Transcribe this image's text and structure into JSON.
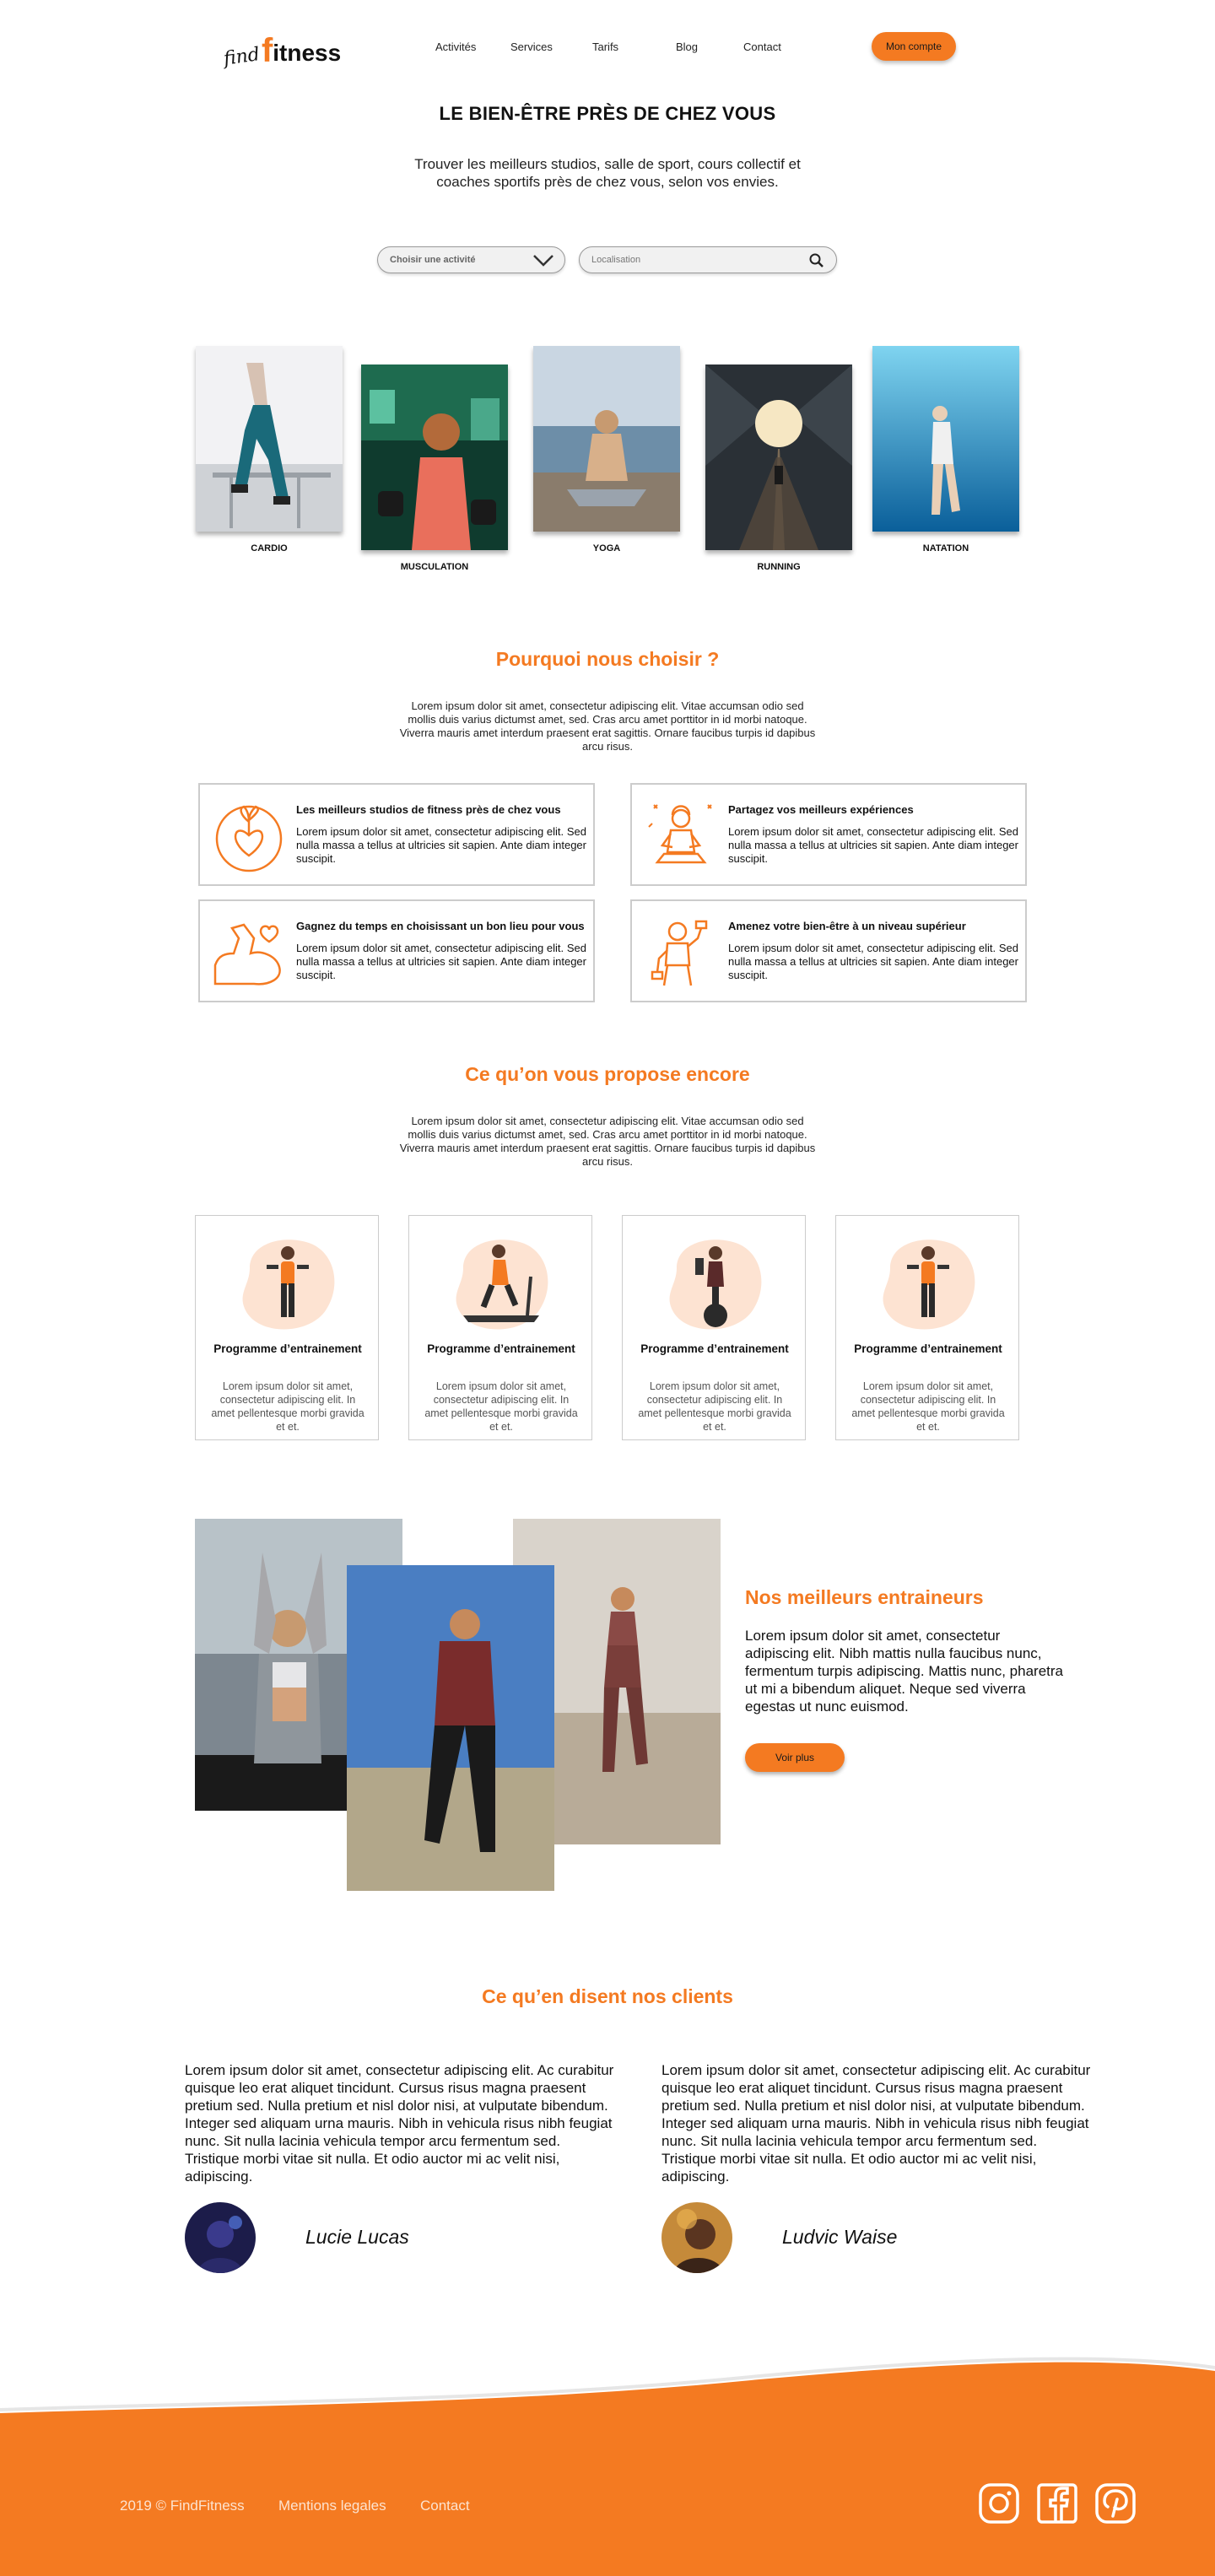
{
  "header": {
    "logo_find": "find",
    "logo_f": "f",
    "logo_rest": "itness",
    "nav": [
      "Activités",
      "Services",
      "Tarifs",
      "Blog",
      "Contact"
    ],
    "account_button": "Mon compte"
  },
  "hero": {
    "title": "LE BIEN-ÊTRE PRÈS DE CHEZ VOUS",
    "subtitle": "Trouver les meilleurs studios, salle de sport, cours collectif et coaches sportifs près de chez vous, selon vos envies.",
    "activity_select": "Choisir une activité",
    "location_placeholder": "Localisation"
  },
  "activities": [
    "CARDIO",
    "MUSCULATION",
    "YOGA",
    "RUNNING",
    "NATATION"
  ],
  "why": {
    "title": "Pourquoi nous choisir ?",
    "text": "Lorem ipsum dolor sit amet, consectetur adipiscing elit. Vitae accumsan odio sed mollis duis varius dictumst amet, sed. Cras arcu amet porttitor in id morbi natoque. Viverra mauris amet interdum praesent erat sagittis. Ornare faucibus turpis id dapibus arcu risus.",
    "features": [
      {
        "title": "Les meilleurs studios de fitness près de chez vous",
        "text": "Lorem ipsum dolor sit amet, consectetur adipiscing elit. Sed nulla massa a tellus at ultricies sit sapien. Ante diam integer suscipit.",
        "icon": "heart-plant-icon"
      },
      {
        "title": "Partagez vos meilleurs expériences",
        "text": "Lorem ipsum dolor sit amet, consectetur adipiscing elit. Sed nulla massa a tellus at ultricies sit sapien. Ante diam integer suscipit.",
        "icon": "meditation-icon"
      },
      {
        "title": "Gagnez du temps en choisissant un bon lieu pour vous",
        "text": "Lorem ipsum dolor sit amet, consectetur adipiscing elit. Sed nulla massa a tellus at ultricies sit sapien. Ante diam integer suscipit.",
        "icon": "biceps-icon"
      },
      {
        "title": "Amenez votre bien-être à un niveau supérieur",
        "text": "Lorem ipsum dolor sit amet, consectetur adipiscing elit. Sed nulla massa a tellus at ultricies sit sapien. Ante diam integer suscipit.",
        "icon": "dumbbell-woman-icon"
      }
    ]
  },
  "offers": {
    "title": "Ce qu’on vous propose encore",
    "text": "Lorem ipsum dolor sit amet, consectetur adipiscing elit. Vitae accumsan odio sed mollis duis varius dictumst amet, sed. Cras arcu amet porttitor in id morbi natoque. Viverra mauris amet interdum praesent erat sagittis. Ornare faucibus turpis id dapibus arcu risus.",
    "programs": [
      {
        "title": "Programme d’entrainement",
        "text": "Lorem ipsum dolor sit amet, consectetur adipiscing elit. In amet pellentesque morbi gravida et et."
      },
      {
        "title": "Programme d’entrainement",
        "text": "Lorem ipsum dolor sit amet, consectetur adipiscing elit. In amet pellentesque morbi gravida et et."
      },
      {
        "title": "Programme d’entrainement",
        "text": "Lorem ipsum dolor sit amet, consectetur adipiscing elit. In amet pellentesque morbi gravida et et."
      },
      {
        "title": "Programme d’entrainement",
        "text": "Lorem ipsum dolor sit amet, consectetur adipiscing elit. In amet pellentesque morbi gravida et et."
      }
    ]
  },
  "trainers": {
    "title": "Nos meilleurs entraineurs",
    "text": "Lorem ipsum dolor sit amet, consectetur adipiscing elit. Nibh mattis nulla faucibus nunc, fermentum turpis adipiscing. Mattis nunc, pharetra ut mi a bibendum aliquet. Neque sed viverra egestas ut nunc euismod.",
    "button": "Voir plus"
  },
  "testimonials": {
    "title": "Ce qu’en disent nos clients",
    "items": [
      {
        "text": "Lorem ipsum dolor sit amet, consectetur adipiscing elit. Ac curabitur quisque leo erat aliquet tincidunt. Cursus risus magna praesent pretium sed. Nulla pretium et nisl dolor nisi, at vulputate bibendum. Integer sed aliquam urna mauris. Nibh in vehicula risus nibh feugiat nunc. Sit nulla lacinia vehicula tempor arcu fermentum sed. Tristique morbi vitae sit nulla. Et odio auctor mi ac velit nisi, adipiscing.",
        "name": "Lucie Lucas"
      },
      {
        "text": "Lorem ipsum dolor sit amet, consectetur adipiscing elit. Ac curabitur quisque leo erat aliquet tincidunt. Cursus risus magna praesent pretium sed. Nulla pretium et nisl dolor nisi, at vulputate bibendum. Integer sed aliquam urna mauris. Nibh in vehicula risus nibh feugiat nunc. Sit nulla lacinia vehicula tempor arcu fermentum sed. Tristique morbi vitae sit nulla. Et odio auctor mi ac velit nisi, adipiscing.",
        "name": "Ludvic Waise"
      }
    ]
  },
  "footer": {
    "copyright": "2019 © FindFitness",
    "legal": "Mentions legales",
    "contact": "Contact",
    "social_icons": [
      "instagram-icon",
      "facebook-icon",
      "pinterest-icon"
    ]
  },
  "colors": {
    "accent": "#F47A21",
    "footer_bg": "#F47A21"
  }
}
